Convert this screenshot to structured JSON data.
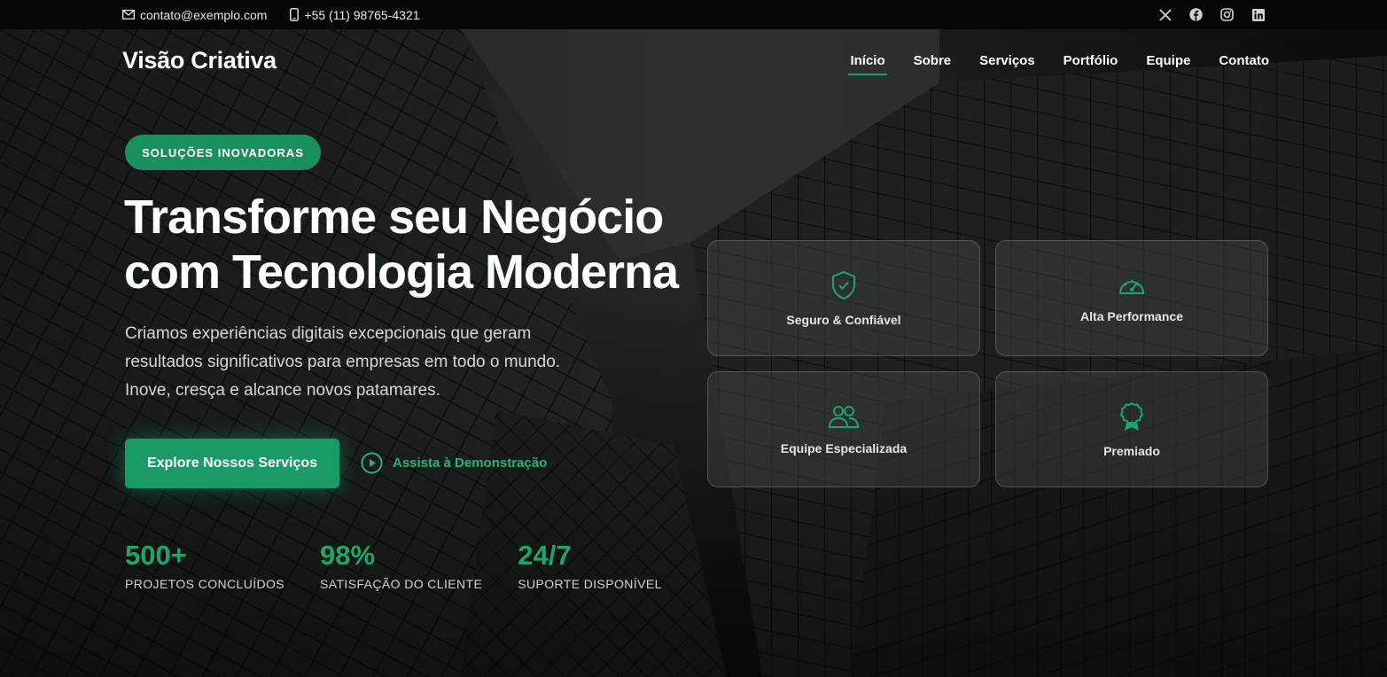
{
  "topbar": {
    "email": "contato@exemplo.com",
    "phone": "+55 (11) 98765-4321",
    "socials": [
      "x-icon",
      "facebook-icon",
      "instagram-icon",
      "linkedin-icon"
    ]
  },
  "header": {
    "brand": "Visão Criativa",
    "nav": [
      {
        "label": "Início",
        "active": true
      },
      {
        "label": "Sobre"
      },
      {
        "label": "Serviços"
      },
      {
        "label": "Portfólio"
      },
      {
        "label": "Equipe"
      },
      {
        "label": "Contato"
      }
    ]
  },
  "hero": {
    "badge": "SOLUÇÕES INOVADORAS",
    "headline_line1": "Transforme seu Negócio",
    "headline_line2": "com Tecnologia Moderna",
    "subtitle": "Criamos experiências digitais excepcionais que geram resultados significativos para empresas em todo o mundo. Inove, cresça e alcance novos patamares.",
    "cta_label": "Explore Nossos Serviços",
    "demo_label": "Assista à Demonstração"
  },
  "stats": [
    {
      "value": "500+",
      "label": "PROJETOS CONCLUÍDOS"
    },
    {
      "value": "98%",
      "label": "SATISFAÇÃO DO CLIENTE"
    },
    {
      "value": "24/7",
      "label": "SUPORTE DISPONÍVEL"
    }
  ],
  "features": [
    {
      "label": "Seguro & Confiável",
      "icon": "shield-check-icon"
    },
    {
      "label": "Alta Performance",
      "icon": "speedometer-icon"
    },
    {
      "label": "Equipe Especializada",
      "icon": "people-icon"
    },
    {
      "label": "Premiado",
      "icon": "award-icon"
    }
  ],
  "colors": {
    "accent": "#1a9a66",
    "accent_text": "#1fa46d",
    "topbar_bg": "#050706"
  }
}
